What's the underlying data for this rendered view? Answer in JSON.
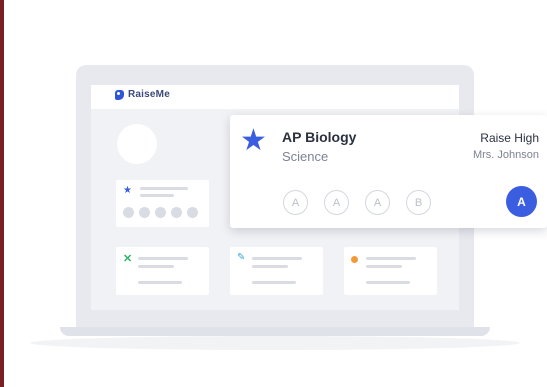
{
  "app": {
    "logo_text": "RaiseMe"
  },
  "course_card": {
    "title": "AP Biology",
    "subject": "Science",
    "school": "Raise High",
    "teacher": "Mrs. Johnson",
    "grades": [
      "A",
      "A",
      "A",
      "B"
    ],
    "current_grade": "A",
    "icon": "star-icon"
  },
  "colors": {
    "accent": "#3b5de0",
    "background_left_strip": "#7a1f24"
  }
}
